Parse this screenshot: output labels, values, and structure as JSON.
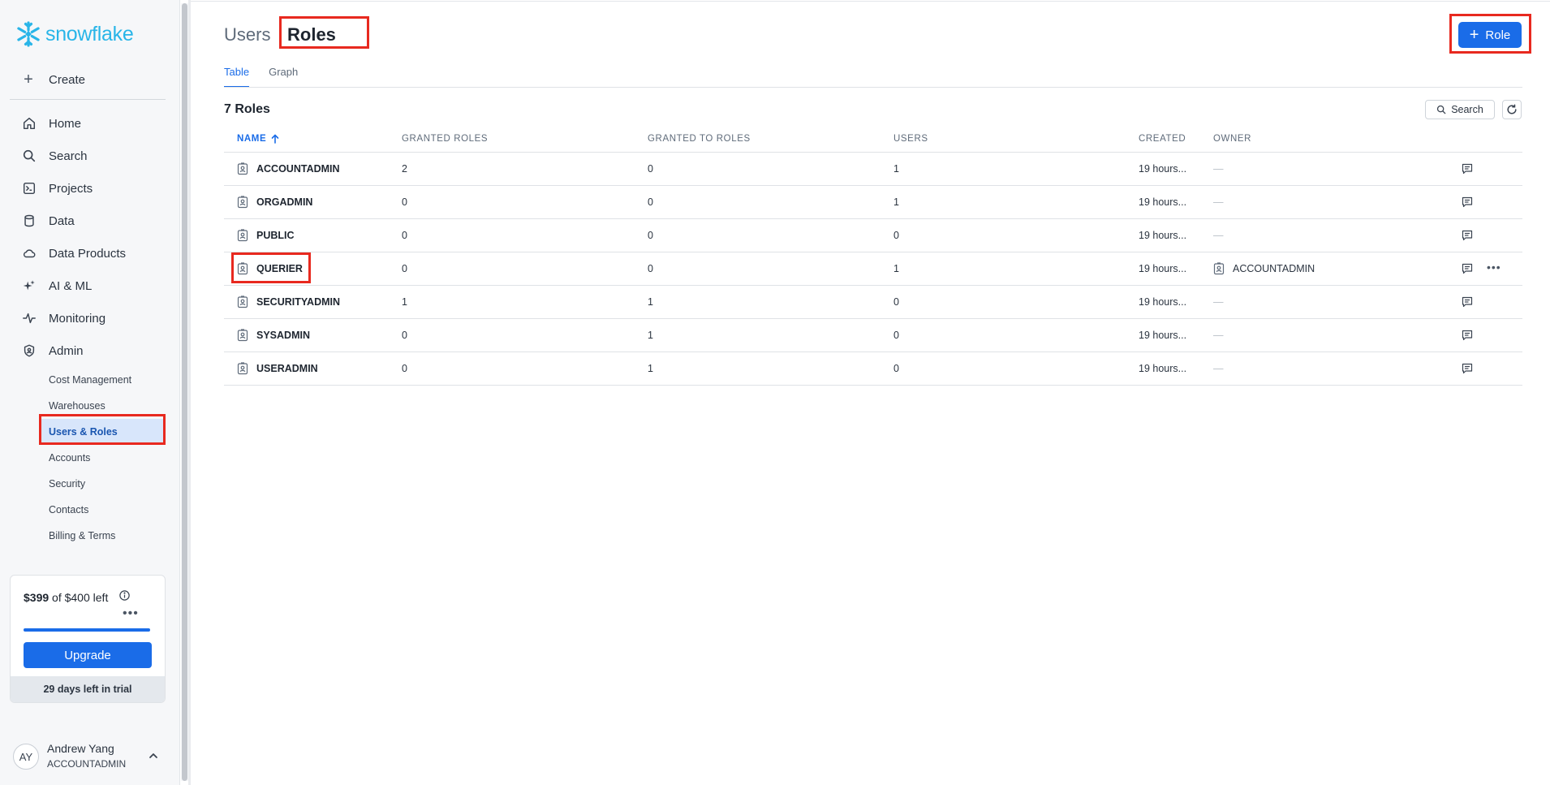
{
  "brand": {
    "name": "snowflake",
    "color": "#29b5e8"
  },
  "sidebar": {
    "create_label": "Create",
    "items": [
      {
        "label": "Home",
        "icon": "home-icon"
      },
      {
        "label": "Search",
        "icon": "search-icon"
      },
      {
        "label": "Projects",
        "icon": "terminal-icon"
      },
      {
        "label": "Data",
        "icon": "database-icon"
      },
      {
        "label": "Data Products",
        "icon": "cloud-icon"
      },
      {
        "label": "AI & ML",
        "icon": "sparkle-icon"
      },
      {
        "label": "Monitoring",
        "icon": "activity-icon"
      },
      {
        "label": "Admin",
        "icon": "shield-icon"
      }
    ],
    "admin_subitems": [
      {
        "label": "Cost Management"
      },
      {
        "label": "Warehouses"
      },
      {
        "label": "Users & Roles",
        "active": true
      },
      {
        "label": "Accounts"
      },
      {
        "label": "Security"
      },
      {
        "label": "Contacts"
      },
      {
        "label": "Billing & Terms"
      }
    ]
  },
  "trial": {
    "amount_used": "$399",
    "amount_of": "of $400",
    "amount_left": "left",
    "progress_fraction": 0.9975,
    "upgrade_label": "Upgrade",
    "days_left": "29 days left in trial"
  },
  "user": {
    "initials": "AY",
    "name": "Andrew Yang",
    "role": "ACCOUNTADMIN"
  },
  "header": {
    "crumb_parent": "Users",
    "crumb_current": "Roles",
    "new_role_label": "Role"
  },
  "tabs": [
    {
      "label": "Table",
      "active": true
    },
    {
      "label": "Graph",
      "active": false
    }
  ],
  "table": {
    "title": "7 Roles",
    "search_label": "Search",
    "columns": [
      "NAME",
      "GRANTED ROLES",
      "GRANTED TO ROLES",
      "USERS",
      "CREATED",
      "OWNER"
    ],
    "rows": [
      {
        "name": "ACCOUNTADMIN",
        "granted_roles": "2",
        "granted_to_roles": "0",
        "users": "1",
        "created": "19 hours...",
        "owner": "—"
      },
      {
        "name": "ORGADMIN",
        "granted_roles": "0",
        "granted_to_roles": "0",
        "users": "1",
        "created": "19 hours...",
        "owner": "—"
      },
      {
        "name": "PUBLIC",
        "granted_roles": "0",
        "granted_to_roles": "0",
        "users": "0",
        "created": "19 hours...",
        "owner": "—"
      },
      {
        "name": "QUERIER",
        "granted_roles": "0",
        "granted_to_roles": "0",
        "users": "1",
        "created": "19 hours...",
        "owner": "ACCOUNTADMIN"
      },
      {
        "name": "SECURITYADMIN",
        "granted_roles": "1",
        "granted_to_roles": "1",
        "users": "0",
        "created": "19 hours...",
        "owner": "—"
      },
      {
        "name": "SYSADMIN",
        "granted_roles": "0",
        "granted_to_roles": "1",
        "users": "0",
        "created": "19 hours...",
        "owner": "—"
      },
      {
        "name": "USERADMIN",
        "granted_roles": "0",
        "granted_to_roles": "1",
        "users": "0",
        "created": "19 hours...",
        "owner": "—"
      }
    ]
  },
  "colors": {
    "accent": "#1a6ce8",
    "annotation": "#e8291f",
    "active_nav_bg": "#d8e6fb"
  }
}
